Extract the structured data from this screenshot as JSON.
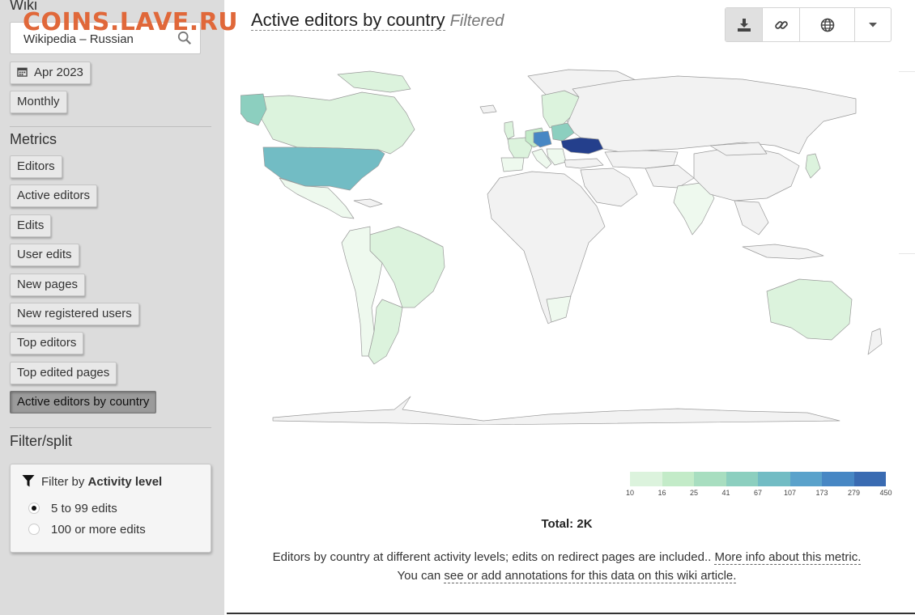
{
  "watermark": "COINS.LAVE.RU",
  "sidebar": {
    "wiki_label": "Wiki",
    "wiki_value": "Wikipedia – Russian",
    "date": "Apr 2023",
    "granularity": "Monthly",
    "metrics_heading": "Metrics",
    "metrics": [
      {
        "label": "Editors"
      },
      {
        "label": "Active editors"
      },
      {
        "label": "Edits"
      },
      {
        "label": "User edits"
      },
      {
        "label": "New pages"
      },
      {
        "label": "New registered users"
      },
      {
        "label": "Top editors"
      },
      {
        "label": "Top edited pages"
      },
      {
        "label": "Active editors by country",
        "active": true
      }
    ],
    "filter_heading": "Filter/split",
    "filter": {
      "prefix": "Filter by",
      "name": "Activity level",
      "options": [
        {
          "label": "5 to 99 edits",
          "selected": true
        },
        {
          "label": "100 or more edits",
          "selected": false
        }
      ]
    }
  },
  "main": {
    "title": "Active editors by country",
    "filtered_tag": "Filtered",
    "toolbar": {
      "icons": [
        "download-icon",
        "link-icon",
        "globe-icon",
        "caret-down-icon"
      ]
    },
    "legend": {
      "ticks": [
        "10",
        "16",
        "25",
        "41",
        "67",
        "107",
        "173",
        "279",
        "450"
      ],
      "colors": [
        "#dcf3dd",
        "#c3ebc8",
        "#a8dec0",
        "#8ccfbf",
        "#72bcc4",
        "#5aa2cb",
        "#4787c4",
        "#3a6bb2",
        "#243f8c"
      ]
    },
    "total": "Total: 2K",
    "description": {
      "text": "Editors by country at different activity levels; edits on redirect pages are included..",
      "more_link": "More info about this metric.",
      "annotations_prefix": "You can",
      "annotations_link": "see or add annotations for this data on this wiki article."
    }
  },
  "colors": {
    "sidebar_bg": "#dcdcdc",
    "watermark": "#e0683a",
    "highest": "#243f8c",
    "no_data": "#f2f2f2"
  }
}
